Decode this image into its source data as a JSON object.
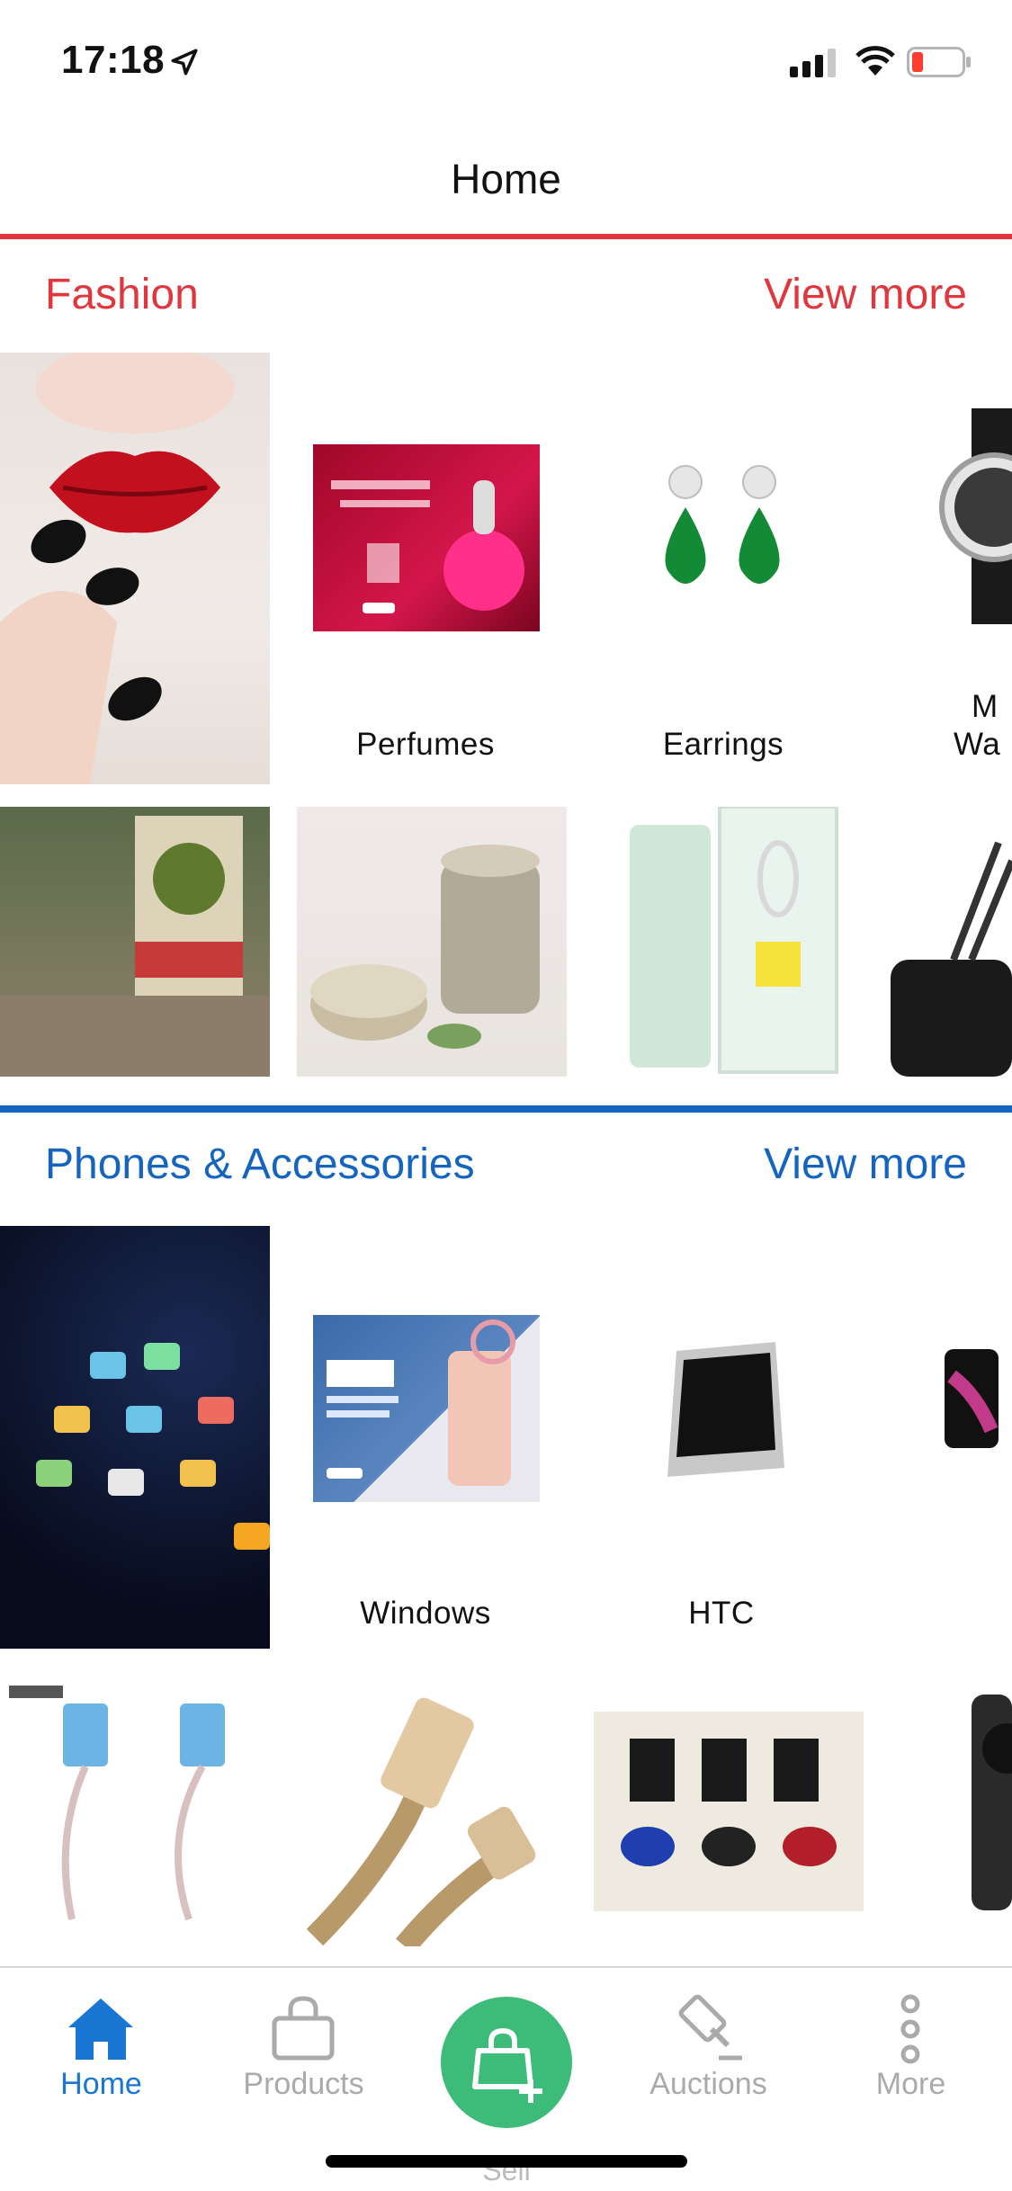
{
  "status_bar": {
    "time": "17:18"
  },
  "nav": {
    "title": "Home"
  },
  "fashion": {
    "title": "Fashion",
    "view_more": "View more",
    "labels": [
      "Perfumes",
      "Earrings",
      "M",
      "Wa"
    ]
  },
  "phones": {
    "title": "Phones & Accessories",
    "view_more": "View more",
    "labels": [
      "Windows",
      "HTC"
    ]
  },
  "tabs": [
    {
      "label": "Home",
      "icon": "home-icon",
      "active": true
    },
    {
      "label": "Products",
      "icon": "shopping-bag-icon",
      "active": false
    },
    {
      "label": "Sell",
      "icon": "bag-plus-icon",
      "active": false
    },
    {
      "label": "Auctions",
      "icon": "gavel-icon",
      "active": false
    },
    {
      "label": "More",
      "icon": "more-vertical-icon",
      "active": false
    }
  ],
  "colors": {
    "fashion_accent": "#e0373f",
    "phones_accent": "#1565c0",
    "tab_active": "#1976d2",
    "sell_button": "#3dbb78"
  }
}
